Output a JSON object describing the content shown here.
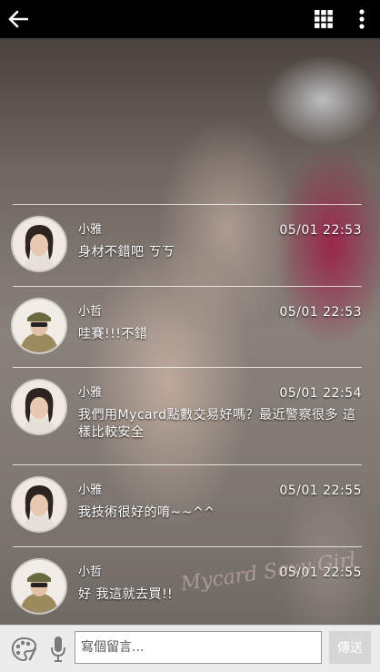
{
  "topbar": {
    "back_icon": "arrow-left-icon",
    "grid_icon": "grid-icon",
    "more_icon": "more-vertical-icon"
  },
  "messages": [
    {
      "name": "小雅",
      "time": "05/01  22:53",
      "text": "身材不錯吧  ㄎㄎ",
      "avatar": "female-avatar"
    },
    {
      "name": "小哲",
      "time": "05/01  22:53",
      "text": "哇賽!!!不錯",
      "avatar": "male-avatar"
    },
    {
      "name": "小雅",
      "time": "05/01  22:54",
      "text": "我們用Mycard點數交易好嗎？最近警察很多  這樣比較安全",
      "avatar": "female-avatar"
    },
    {
      "name": "小雅",
      "time": "05/01  22:55",
      "text": "我技術很好的唷~~^^",
      "avatar": "female-avatar"
    },
    {
      "name": "小哲",
      "time": "05/01  22:55",
      "text": "好  我這就去買!!",
      "avatar": "male-avatar"
    }
  ],
  "watermark": "Mycard Sexy Girl",
  "composer": {
    "placeholder": "寫個留言...",
    "send_label": "傳送",
    "palette_icon": "palette-icon",
    "mic_icon": "microphone-icon"
  },
  "colors": {
    "topbar": "#000000",
    "bottombar": "#ececec",
    "accent_bg": "#a01946"
  }
}
